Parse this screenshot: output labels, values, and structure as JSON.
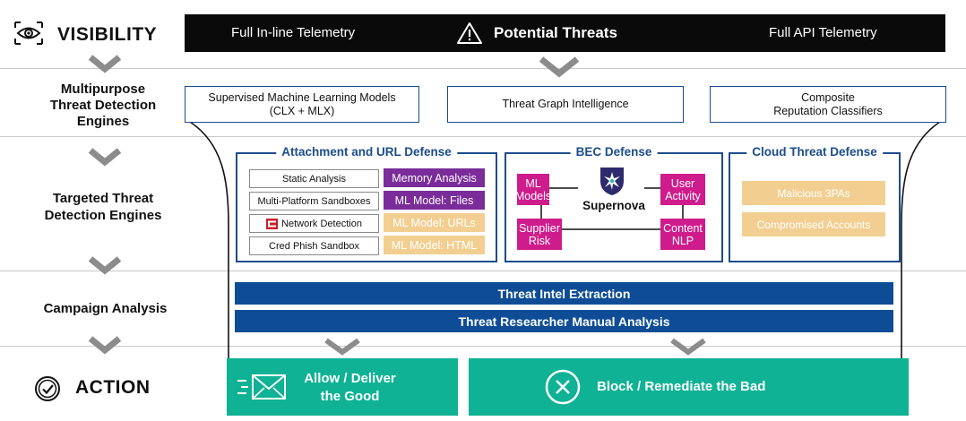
{
  "rows": {
    "visibility": "VISIBILITY",
    "multipurpose": [
      "Multipurpose",
      "Threat Detection",
      "Engines"
    ],
    "targeted": [
      "Targeted Threat",
      "Detection Engines"
    ],
    "campaign": "Campaign Analysis",
    "action": "ACTION"
  },
  "top_bar": {
    "left": "Full In-line Telemetry",
    "center": "Potential Threats",
    "right": "Full API Telemetry"
  },
  "engines": {
    "supervised": [
      "Supervised Machine Learning Models",
      "(CLX + MLX)"
    ],
    "graph": "Threat Graph Intelligence",
    "composite": [
      "Composite",
      "Reputation Classifiers"
    ]
  },
  "attachment_panel": {
    "title": "Attachment and URL Defense",
    "left_items": [
      "Static Analysis",
      "Multi-Platform Sandboxes",
      "Network Detection",
      "Cred Phish Sandbox"
    ],
    "right_items": [
      "Memory Analysis",
      "ML Model: Files",
      "ML Model: URLs",
      "ML Model: HTML"
    ],
    "colors": {
      "purple": "#7a2c9a",
      "tan": "#f2cf91"
    }
  },
  "bec_panel": {
    "title": "BEC Defense",
    "nodes": {
      "ml_models": [
        "ML",
        "Models"
      ],
      "user_activity": [
        "User",
        "Activity"
      ],
      "supplier_risk": [
        "Supplier",
        "Risk"
      ],
      "content_nlp": [
        "Content",
        "NLP"
      ]
    },
    "center_label": "Supernova",
    "color": "#cf1c8c"
  },
  "cloud_panel": {
    "title": "Cloud Threat Defense",
    "items": [
      "Malicious 3PAs",
      "Compromised Accounts"
    ]
  },
  "campaign_bars": [
    "Threat Intel Extraction",
    "Threat Researcher Manual Analysis"
  ],
  "actions": {
    "allow": [
      "Allow / Deliver",
      "the Good"
    ],
    "block": "Block / Remediate the Bad"
  },
  "palette": {
    "navy": "#0e4d96",
    "teal": "#0fb294",
    "chevron": "#8c8c8c"
  }
}
